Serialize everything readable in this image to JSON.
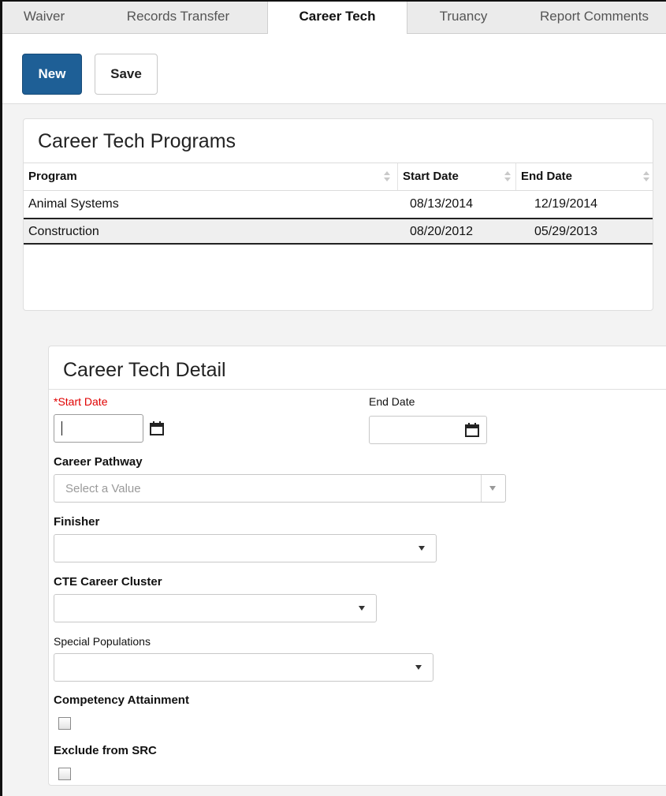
{
  "tabs": [
    {
      "label": "Waiver"
    },
    {
      "label": "Records Transfer"
    },
    {
      "label": "Career Tech",
      "active": true
    },
    {
      "label": "Truancy"
    },
    {
      "label": "Report Comments"
    }
  ],
  "toolbar": {
    "new_label": "New",
    "save_label": "Save"
  },
  "programs": {
    "title": "Career Tech Programs",
    "columns": [
      "Program",
      "Start Date",
      "End Date"
    ],
    "rows": [
      {
        "program": "Animal Systems",
        "start": "08/13/2014",
        "end": "12/19/2014"
      },
      {
        "program": "Construction",
        "start": "08/20/2012",
        "end": "05/29/2013",
        "selected": true
      }
    ]
  },
  "detail": {
    "title": "Career Tech Detail",
    "start_date_label": "*Start Date",
    "start_date_value": "",
    "end_date_label": "End Date",
    "end_date_value": "",
    "career_pathway_label": "Career Pathway",
    "career_pathway_placeholder": "Select a Value",
    "finisher_label": "Finisher",
    "cte_cluster_label": "CTE Career Cluster",
    "special_populations_label": "Special Populations",
    "competency_label": "Competency Attainment",
    "exclude_src_label": "Exclude from SRC"
  },
  "icons": {
    "calendar": "calendar-icon",
    "dropdown": "chevron-down-icon"
  },
  "colors": {
    "primary_button": "#1e5f96",
    "required_label": "#e00000"
  }
}
